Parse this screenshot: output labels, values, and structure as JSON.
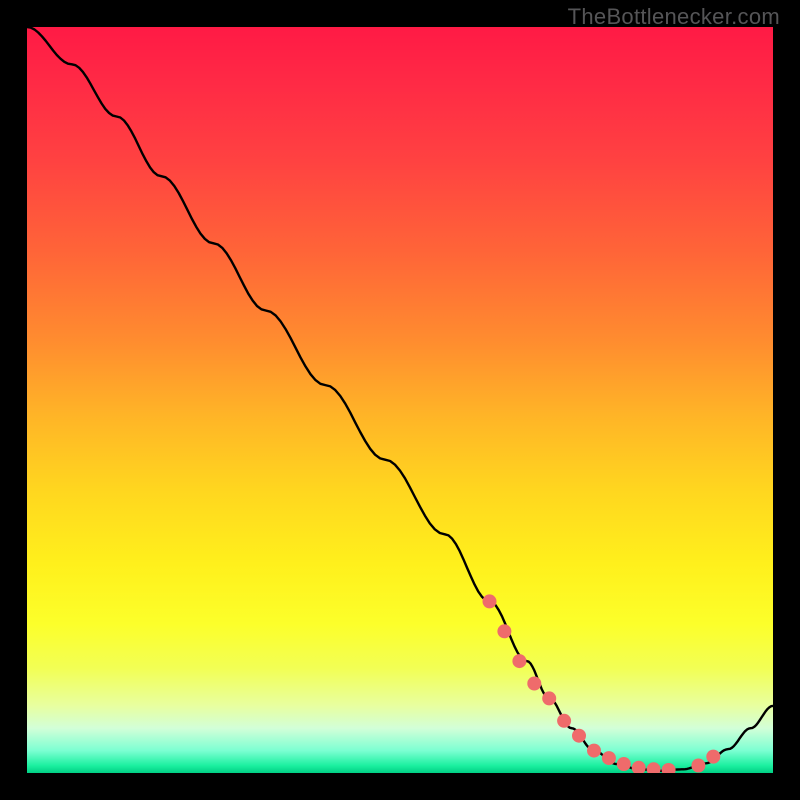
{
  "watermark": "TheBottlenecker.com",
  "chart_data": {
    "type": "line",
    "title": "",
    "xlabel": "",
    "ylabel": "",
    "xlim": [
      0,
      100
    ],
    "ylim": [
      0,
      100
    ],
    "x": [
      0,
      6,
      12,
      18,
      25,
      32,
      40,
      48,
      56,
      62,
      67,
      70,
      73,
      76,
      79,
      82,
      85,
      88,
      91,
      94,
      97,
      100
    ],
    "values": [
      100,
      95,
      88,
      80,
      71,
      62,
      52,
      42,
      32,
      23,
      15,
      10,
      6,
      3,
      1.2,
      0.5,
      0.3,
      0.5,
      1.3,
      3.2,
      6,
      9
    ],
    "markers": {
      "x": [
        62,
        64,
        66,
        68,
        70,
        72,
        74,
        76,
        78,
        80,
        82,
        84,
        86,
        90,
        92
      ],
      "values": [
        23,
        19,
        15,
        12,
        10,
        7,
        5,
        3,
        2,
        1.2,
        0.7,
        0.5,
        0.4,
        1.0,
        2.2
      ],
      "color": "#ef6b6b"
    }
  }
}
